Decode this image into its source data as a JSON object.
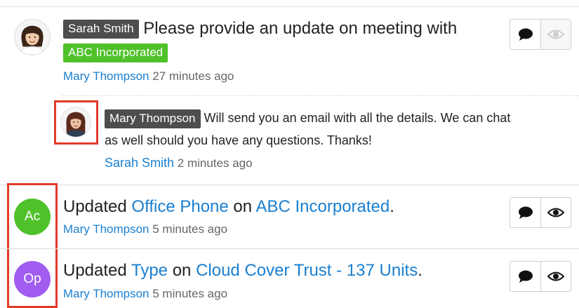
{
  "feed": {
    "post1": {
      "author_tag": "Sarah Smith",
      "message": "Please provide an update on meeting with",
      "record_tag": "ABC Incorporated",
      "meta_user": "Mary Thompson",
      "meta_time": "27 minutes ago",
      "reply": {
        "author_tag": "Mary Thompson",
        "line1": "Will send you an email with all the details. We can chat",
        "line2": "as well should you have any questions. Thanks!",
        "meta_user": "Sarah Smith",
        "meta_time": "2 minutes ago"
      }
    },
    "post2": {
      "initials": "Ac",
      "avatar_color": "#4fc129",
      "prefix": "Updated",
      "field": "Office Phone",
      "connector": "on",
      "record": "ABC Incorporated",
      "suffix": ".",
      "meta_user": "Mary Thompson",
      "meta_time": "5 minutes ago"
    },
    "post3": {
      "initials": "Op",
      "avatar_color": "#a15cf0",
      "prefix": "Updated",
      "field": "Type",
      "connector": "on",
      "record": "Cloud Cover Trust - 137 Units",
      "suffix": ".",
      "meta_user": "Mary Thompson",
      "meta_time": "5 minutes ago"
    }
  },
  "icons": {
    "comment": "comment-icon",
    "eye": "eye-icon"
  },
  "colors": {
    "link": "#1a7fd0",
    "highlight": "#e23a2a",
    "tag_dark": "#4d4d4d",
    "tag_green": "#4fc129"
  }
}
